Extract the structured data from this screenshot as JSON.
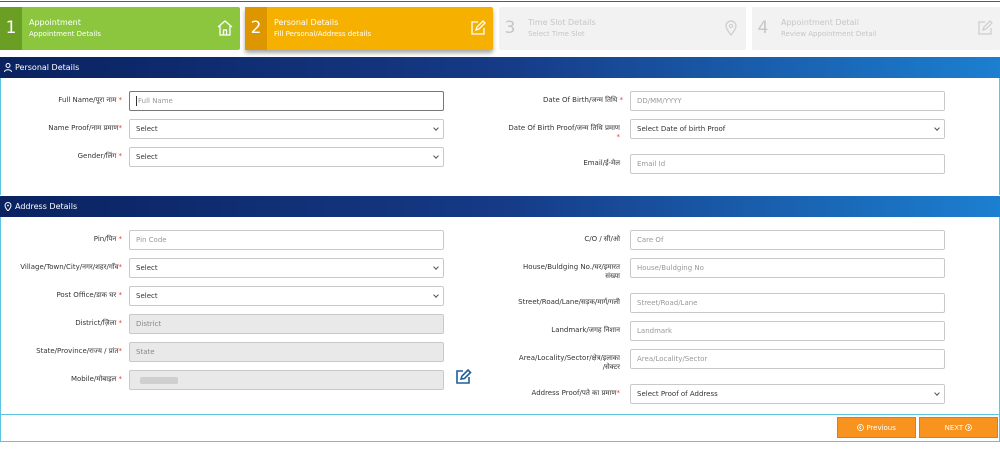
{
  "steps": [
    {
      "number": "1",
      "title": "Appointment",
      "subtitle": "Appointment Details",
      "icon": "home-icon"
    },
    {
      "number": "2",
      "title": "Personal Details",
      "subtitle": "Fill Personal/Address details",
      "icon": "edit-icon"
    },
    {
      "number": "3",
      "title": "Time Slot Details",
      "subtitle": "Select Time Slot",
      "icon": "location-pin-icon"
    },
    {
      "number": "4",
      "title": "Appointment Detail",
      "subtitle": "Review Appointment Detail",
      "icon": "edit-icon"
    }
  ],
  "personal": {
    "header": "Personal Details",
    "full_name": {
      "label": "Full Name/पूरा नाम",
      "placeholder": "Full Name"
    },
    "name_proof": {
      "label": "Name Proof/नाम प्रमाण",
      "value": "Select"
    },
    "gender": {
      "label": "Gender/लिंग",
      "value": "Select"
    },
    "dob": {
      "label": "Date Of Birth/जन्म तिथि",
      "placeholder": "DD/MM/YYYY"
    },
    "dob_proof": {
      "label": "Date Of Birth Proof/जन्म तिथि प्रमाण",
      "value": "Select Date of birth Proof"
    },
    "email": {
      "label": "Email/ई-मेल",
      "placeholder": "Email Id"
    }
  },
  "address": {
    "header": "Address Details",
    "pin": {
      "label": "Pin/पिन",
      "placeholder": "Pin Code"
    },
    "village": {
      "label": "Village/Town/City/नगर/शहर/गाँव",
      "value": "Select"
    },
    "post_office": {
      "label": "Post Office/डाक घर",
      "value": "Select"
    },
    "district": {
      "label": "District/ज़िला",
      "placeholder": "District"
    },
    "state": {
      "label": "State/Province/राज्य / प्रांत",
      "placeholder": "State"
    },
    "mobile": {
      "label": "Mobile/मोबाइल"
    },
    "care_of": {
      "label": "C/O / सी/ओ",
      "placeholder": "Care Of"
    },
    "house": {
      "label_line1": "House/Buldging No./घर/इमारत",
      "label_line2": "संख्या",
      "placeholder": "House/Buldging No"
    },
    "street": {
      "label": "Street/Road/Lane/सड़क/मार्ग/गली",
      "placeholder": "Street/Road/Lane"
    },
    "landmark": {
      "label": "Landmark/जगह निशान",
      "placeholder": "Landmark"
    },
    "area": {
      "label_line1": "Area/Locality/Sector/क्षेत्र/इलाका",
      "label_line2": "/सेक्टर",
      "placeholder": "Area/Locality/Sector"
    },
    "address_proof": {
      "label": "Address Proof/पते का प्रमाण",
      "value": "Select Proof of Address"
    }
  },
  "buttons": {
    "previous": "Previous",
    "next": "NEXT"
  },
  "required_mark": "*",
  "colors": {
    "step_done": "#8cc63f",
    "step_active": "#f6b000",
    "step_pending": "#f2f2f2",
    "header_dark": "#0a2260",
    "button": "#f7931e",
    "required": "#e53935"
  }
}
